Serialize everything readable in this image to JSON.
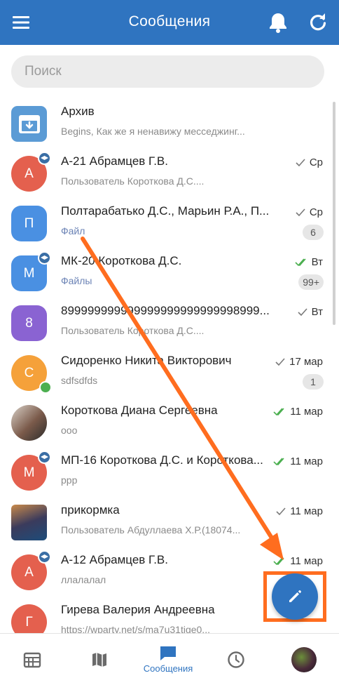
{
  "header": {
    "title": "Сообщения",
    "menu_icon": "menu-icon",
    "bell_icon": "bell-icon",
    "refresh_icon": "refresh-icon"
  },
  "search": {
    "placeholder": "Поиск"
  },
  "chats": [
    {
      "name": "Архив",
      "preview": "Begins, Как же я ненавижу месседжинг...",
      "avatar_letter": "",
      "avatar_color": "#5b9bd5",
      "time": "",
      "count": ""
    },
    {
      "name": "А-21 Абрамцев Г.В.",
      "preview": "Пользователь Короткова Д.С....",
      "avatar_letter": "А",
      "avatar_color": "#e4604e",
      "time": "Ср",
      "count": "",
      "status": "sent"
    },
    {
      "name": "Полтарабатько Д.С., Марьин Р.А., П...",
      "preview": "Файл",
      "avatar_letter": "П",
      "avatar_color": "#4a90e2",
      "time": "Ср",
      "count": "6",
      "status": "sent"
    },
    {
      "name": "МК-20 Короткова Д.С.",
      "preview": "Файлы",
      "avatar_letter": "М",
      "avatar_color": "#4a90e2",
      "time": "Вт",
      "count": "99+",
      "status": "read"
    },
    {
      "name": "899999999999999999999999998999...",
      "preview": "Пользователь Короткова Д.С....",
      "avatar_letter": "8",
      "avatar_color": "#8a63d2",
      "time": "Вт",
      "count": "",
      "status": "sent"
    },
    {
      "name": "Сидоренко Никита Викторович",
      "preview": "sdfsdfds",
      "avatar_letter": "С",
      "avatar_color": "#f5a13a",
      "time": "17 мар",
      "count": "1",
      "status": "sent"
    },
    {
      "name": "Короткова Диана Сергеевна",
      "preview": "ооо",
      "avatar_letter": "",
      "avatar_color": "#7a5a4a",
      "time": "11 мар",
      "count": "",
      "status": "read"
    },
    {
      "name": "МП-16 Короткова Д.С. и Короткова...",
      "preview": "ppp",
      "avatar_letter": "М",
      "avatar_color": "#e4604e",
      "time": "11 мар",
      "count": "",
      "status": "read"
    },
    {
      "name": "прикормка",
      "preview": "Пользователь Абдуллаева Х.Р.(18074...",
      "avatar_letter": "",
      "avatar_color": "#3b3b5c",
      "time": "11 мар",
      "count": "",
      "status": "sent"
    },
    {
      "name": "А-12 Абрамцев Г.В.",
      "preview": "ллалалал",
      "avatar_letter": "А",
      "avatar_color": "#e4604e",
      "time": "11 мар",
      "count": "",
      "status": "read"
    },
    {
      "name": "Гирева Валерия Андреевна",
      "preview": "https://wparty.net/s/ma7u31tige0...",
      "avatar_letter": "Г",
      "avatar_color": "#e4604e",
      "time": "",
      "count": "",
      "status": ""
    }
  ],
  "bottom_nav": {
    "active_label": "Сообщения"
  },
  "colors": {
    "primary": "#2f74c0",
    "annotation": "#ff6d1f",
    "read_check": "#4caf50"
  }
}
